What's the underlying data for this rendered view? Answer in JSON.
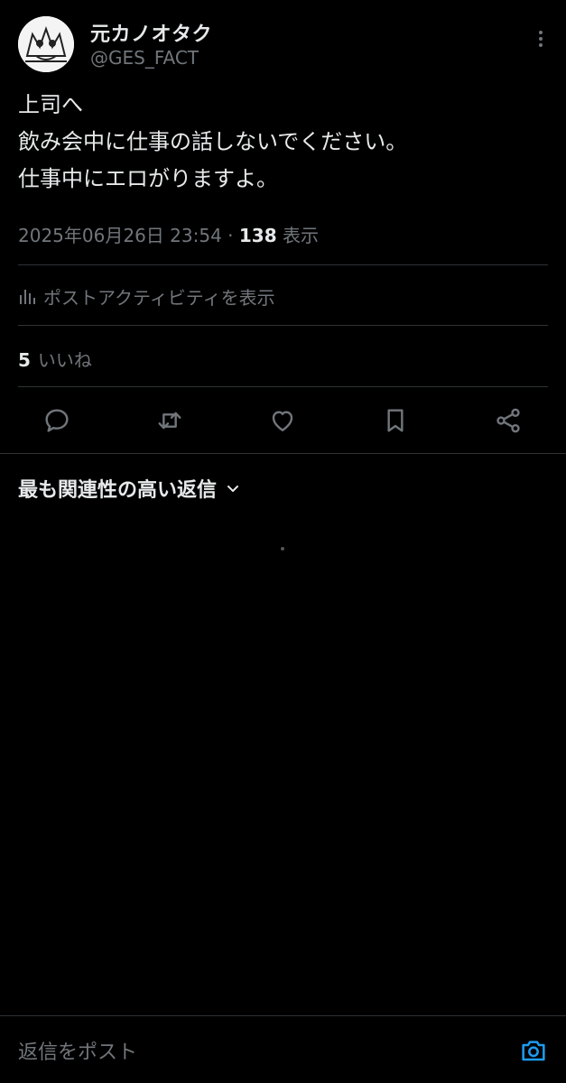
{
  "author": {
    "name": "元カノオタク",
    "handle": "@GES_FACT"
  },
  "tweet": {
    "lines": [
      "上司へ",
      "飲み会中に仕事の話しないでください。",
      "仕事中にエロがりますよ。"
    ]
  },
  "meta": {
    "datetime": "2025年06月26日 23:54",
    "separator": "·",
    "views_count": "138",
    "views_label": "表示"
  },
  "activity": {
    "label": "ポストアクティビティを表示"
  },
  "likes": {
    "count": "5",
    "label": "いいね"
  },
  "replies": {
    "sort_label": "最も関連性の高い返信"
  },
  "reply_bar": {
    "placeholder": "返信をポスト"
  },
  "colors": {
    "background": "#000000",
    "text": "#e7e9ea",
    "secondary": "#71767b",
    "divider": "#2f3336",
    "accent": "#1d9bf0"
  },
  "icons": {
    "more": "more-icon",
    "activity": "bar-chart-icon",
    "reply": "reply-icon",
    "retweet": "retweet-icon",
    "like": "heart-icon",
    "bookmark": "bookmark-icon",
    "share": "share-icon",
    "sort": "chevron-down-icon",
    "camera": "camera-icon"
  }
}
